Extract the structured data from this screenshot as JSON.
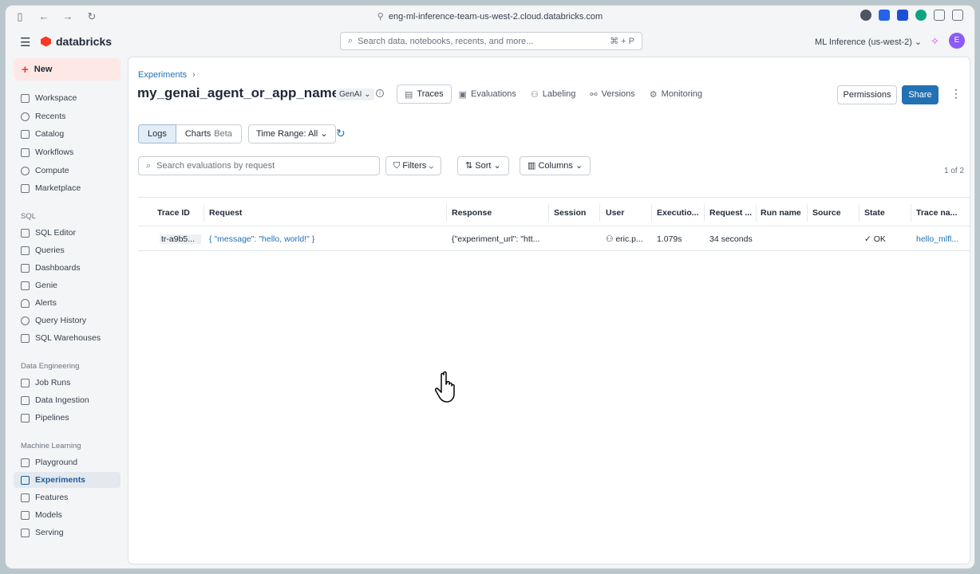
{
  "browser": {
    "url": "eng-ml-inference-team-us-west-2.cloud.databricks.com"
  },
  "app": {
    "logo": "databricks",
    "search_placeholder": "Search data, notebooks, recents, and more...",
    "search_shortcut": "⌘ + P",
    "workspace": "ML Inference (us-west-2)",
    "avatar_letter": "E"
  },
  "sidebar": {
    "new_label": "New",
    "items_main": [
      "Workspace",
      "Recents",
      "Catalog",
      "Workflows",
      "Compute",
      "Marketplace"
    ],
    "sql_header": "SQL",
    "items_sql": [
      "SQL Editor",
      "Queries",
      "Dashboards",
      "Genie",
      "Alerts",
      "Query History",
      "SQL Warehouses"
    ],
    "de_header": "Data Engineering",
    "items_de": [
      "Job Runs",
      "Data Ingestion",
      "Pipelines"
    ],
    "ml_header": "Machine Learning",
    "items_ml": [
      "Playground",
      "Experiments",
      "Features",
      "Models",
      "Serving"
    ]
  },
  "page": {
    "breadcrumb": "Experiments",
    "title": "my_genai_agent_or_app_name",
    "badge": "GenAI",
    "tabs": [
      "Traces",
      "Evaluations",
      "Labeling",
      "Versions",
      "Monitoring"
    ],
    "permissions": "Permissions",
    "share": "Share"
  },
  "toolbar": {
    "logs": "Logs",
    "charts": "Charts",
    "beta": "Beta",
    "time_range": "Time Range: All",
    "search_placeholder": "Search evaluations by request",
    "filters": "Filters",
    "sort": "Sort",
    "columns": "Columns",
    "pager": "1 of 2"
  },
  "table": {
    "headers": [
      "Trace ID",
      "Request",
      "Response",
      "Session",
      "User",
      "Executio...",
      "Request ...",
      "Run name",
      "Source",
      "State",
      "Trace na..."
    ],
    "row": {
      "trace_id": "tr-a9b5...",
      "request": "{ \"message\": \"hello, world!\" }",
      "response": "{\"experiment_url\": \"htt...",
      "session": "",
      "user": "eric.p...",
      "execution": "1.079s",
      "request_time": "34 seconds",
      "run_name": "",
      "source": "",
      "state": "OK",
      "trace_name": "hello_mlfl..."
    }
  }
}
